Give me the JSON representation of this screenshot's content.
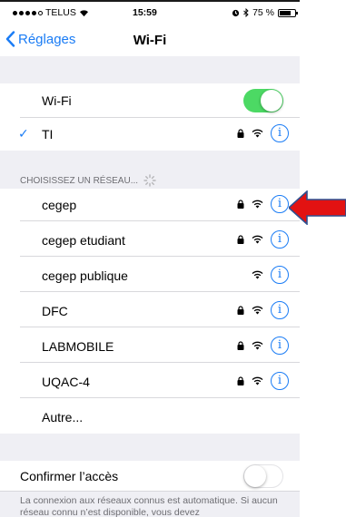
{
  "status_bar": {
    "carrier": "TELUS",
    "time": "15:59",
    "battery_percent": "75 %",
    "battery_level": 0.75
  },
  "nav": {
    "back_label": "Réglages",
    "title": "Wi-Fi"
  },
  "wifi": {
    "label": "Wi-Fi",
    "enabled": true
  },
  "connected": {
    "name": "TI",
    "locked": true
  },
  "networks_header": "CHOISISSEZ UN RÉSEAU...",
  "networks": [
    {
      "name": "cegep",
      "locked": true
    },
    {
      "name": "cegep etudiant",
      "locked": true
    },
    {
      "name": "cegep publique",
      "locked": false
    },
    {
      "name": "DFC",
      "locked": true
    },
    {
      "name": "LABMOBILE",
      "locked": true
    },
    {
      "name": "UQAC-4",
      "locked": true
    }
  ],
  "other_label": "Autre...",
  "ask_join": {
    "label": "Confirmer l’accès",
    "enabled": false
  },
  "footer_text": "La connexion aux réseaux connus est automatique. Si aucun réseau connu n’est disponible, vous devez",
  "colors": {
    "accent": "#1a7cf5",
    "toggle_on": "#4cd964",
    "arrow": "#e21212"
  },
  "icons": {
    "signal": "signal-dots-icon",
    "wifi": "wifi-icon",
    "lock": "lock-icon",
    "info": "info-icon",
    "check": "checkmark-icon",
    "back": "chevron-left-icon",
    "spinner": "spinner-icon",
    "annotation": "red-arrow-icon"
  }
}
